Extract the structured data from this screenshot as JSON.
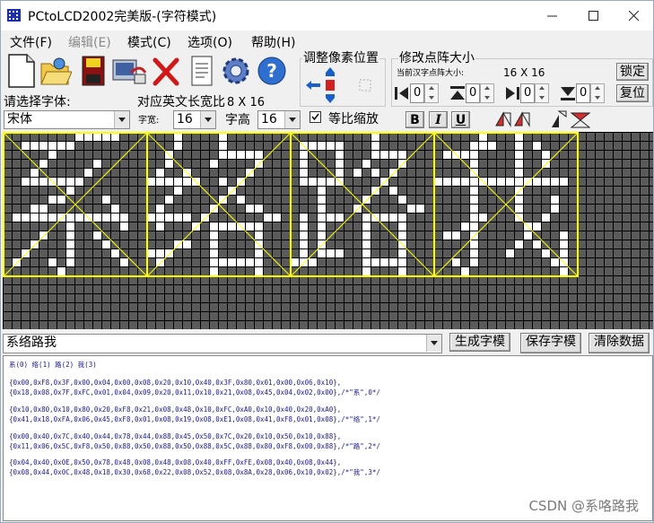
{
  "window": {
    "title": "PCtoLCD2002完美版-(字符模式)",
    "controls": [
      "minimize",
      "maximize",
      "close"
    ]
  },
  "menu": [
    {
      "label": "文件(F)",
      "enabled": true
    },
    {
      "label": "编辑(E)",
      "enabled": false
    },
    {
      "label": "模式(C)",
      "enabled": true
    },
    {
      "label": "选项(O)",
      "enabled": true
    },
    {
      "label": "帮助(H)",
      "enabled": true
    }
  ],
  "toolbar": [
    "new-file-icon",
    "open-folder-icon",
    "save-disk-icon",
    "options-icon",
    "delete-icon",
    "notepad-icon",
    "settings-gear-icon",
    "help-icon"
  ],
  "adjust_group": {
    "title": "调整像素位置"
  },
  "resize_group": {
    "title": "修改点阵大小",
    "current_label": "当前汉字点阵大小:",
    "current_value": "16 X 16",
    "lock_label": "锁定",
    "reset_label": "复位",
    "spins": [
      "0",
      "0",
      "0",
      "0"
    ]
  },
  "font": {
    "select_label": "请选择字体:",
    "select_value": "宋体",
    "ratio_label": "对应英文长宽比",
    "ratio_value": "8 X 16",
    "width_label": "字宽:",
    "width_value": "16",
    "height_label": "字高",
    "height_value": "16",
    "proportional_label": "等比缩放",
    "proportional_checked": true,
    "bold": "B",
    "italic": "I",
    "underline": "U"
  },
  "colors": {
    "dot_on": "#ffffff",
    "dot_off": "#5a5a5a",
    "grid": "#000000",
    "frame": "#ffff00",
    "output_text": "#1a1a8c"
  },
  "input": {
    "value": "系络路我",
    "generate_label": "生成字模",
    "save_label": "保存字模",
    "clear_label": "清除数据"
  },
  "output": {
    "header": "系(0) 络(1) 路(2) 我(3)",
    "blocks": [
      [
        "{0x00,0xF8,0x3F,0x00,0x04,0x00,0x08,0x20,0x10,0x40,0x3F,0x80,0x01,0x00,0x06,0x10},",
        "{0x18,0x08,0x7F,0xFC,0x01,0x04,0x09,0x20,0x11,0x10,0x21,0x08,0x45,0x04,0x02,0x00},/*\"系\",0*/"
      ],
      [
        "{0x10,0x80,0x10,0x80,0x20,0xF8,0x21,0x08,0x48,0x10,0xFC,0xA0,0x10,0x40,0x20,0xA0},",
        "{0x41,0x18,0xFA,0x06,0x45,0xF8,0x01,0x08,0x19,0x08,0xE1,0x08,0x41,0xF8,0x01,0x08},/*\"络\",1*/"
      ],
      [
        "{0x00,0x40,0x7C,0x40,0x44,0x78,0x44,0x88,0x45,0x50,0x7C,0x20,0x10,0x50,0x10,0x88},",
        "{0x11,0x06,0x5C,0xF8,0x50,0x88,0x50,0x88,0x50,0x88,0x5C,0x88,0x80,0xF8,0x00,0x88},/*\"路\",2*/"
      ],
      [
        "{0x04,0x40,0x0E,0x50,0x78,0x48,0x08,0x48,0x08,0x40,0xFF,0xFE,0x08,0x40,0x08,0x44},",
        "{0x08,0x44,0x0C,0x48,0x18,0x30,0x68,0x22,0x08,0x52,0x08,0x8A,0x28,0x06,0x10,0x02},/*\"我\",3*/"
      ]
    ]
  },
  "watermark": "CSDN @系咯路我",
  "glyphs": [
    {
      "char": "系",
      "rows": [
        [
          0,
          0,
          0,
          0,
          0,
          0,
          0,
          0,
          1,
          1,
          1,
          1,
          1,
          0,
          0,
          0
        ],
        [
          0,
          0,
          1,
          1,
          1,
          1,
          1,
          1,
          0,
          0,
          0,
          0,
          0,
          0,
          0,
          0
        ],
        [
          0,
          0,
          0,
          0,
          0,
          1,
          0,
          0,
          0,
          0,
          0,
          0,
          0,
          0,
          0,
          0
        ],
        [
          0,
          0,
          0,
          0,
          1,
          0,
          0,
          0,
          0,
          0,
          1,
          0,
          0,
          0,
          0,
          0
        ],
        [
          0,
          0,
          0,
          1,
          0,
          0,
          0,
          0,
          0,
          1,
          0,
          0,
          0,
          0,
          0,
          0
        ],
        [
          0,
          0,
          1,
          1,
          1,
          1,
          1,
          1,
          1,
          0,
          0,
          0,
          0,
          0,
          0,
          0
        ],
        [
          0,
          0,
          0,
          0,
          0,
          0,
          0,
          1,
          0,
          0,
          0,
          0,
          0,
          0,
          0,
          0
        ],
        [
          0,
          0,
          0,
          0,
          0,
          1,
          1,
          0,
          0,
          0,
          0,
          1,
          0,
          0,
          0,
          0
        ],
        [
          0,
          0,
          0,
          1,
          1,
          0,
          0,
          0,
          0,
          0,
          0,
          0,
          1,
          0,
          0,
          0
        ],
        [
          0,
          1,
          1,
          1,
          1,
          1,
          1,
          1,
          1,
          1,
          1,
          1,
          1,
          1,
          0,
          0
        ],
        [
          0,
          0,
          0,
          0,
          0,
          0,
          0,
          1,
          0,
          0,
          0,
          0,
          0,
          1,
          0,
          0
        ],
        [
          0,
          0,
          0,
          0,
          1,
          0,
          0,
          1,
          0,
          0,
          1,
          0,
          0,
          0,
          0,
          0
        ],
        [
          0,
          0,
          0,
          1,
          0,
          0,
          0,
          1,
          0,
          0,
          0,
          1,
          0,
          0,
          0,
          0
        ],
        [
          0,
          0,
          1,
          0,
          0,
          0,
          0,
          1,
          0,
          0,
          0,
          0,
          1,
          0,
          0,
          0
        ],
        [
          0,
          1,
          0,
          0,
          0,
          1,
          0,
          1,
          0,
          0,
          0,
          0,
          0,
          1,
          0,
          0
        ],
        [
          0,
          0,
          0,
          0,
          0,
          0,
          1,
          0,
          0,
          0,
          0,
          0,
          0,
          0,
          0,
          0
        ]
      ]
    },
    {
      "char": "络",
      "rows": [
        [
          0,
          0,
          0,
          1,
          0,
          0,
          0,
          0,
          1,
          0,
          0,
          0,
          0,
          0,
          0,
          0
        ],
        [
          0,
          0,
          0,
          1,
          0,
          0,
          0,
          0,
          1,
          0,
          0,
          0,
          0,
          0,
          0,
          0
        ],
        [
          0,
          0,
          1,
          0,
          0,
          0,
          0,
          0,
          1,
          1,
          1,
          1,
          1,
          0,
          0,
          0
        ],
        [
          0,
          0,
          1,
          0,
          0,
          0,
          0,
          1,
          0,
          0,
          0,
          0,
          1,
          0,
          0,
          0
        ],
        [
          0,
          1,
          0,
          0,
          1,
          0,
          0,
          0,
          0,
          0,
          0,
          1,
          0,
          0,
          0,
          0
        ],
        [
          1,
          1,
          1,
          1,
          1,
          1,
          0,
          0,
          1,
          0,
          1,
          0,
          0,
          0,
          0,
          0
        ],
        [
          0,
          0,
          0,
          1,
          0,
          0,
          0,
          0,
          0,
          1,
          0,
          0,
          0,
          0,
          0,
          0
        ],
        [
          0,
          0,
          1,
          0,
          0,
          0,
          0,
          0,
          1,
          0,
          1,
          0,
          0,
          0,
          0,
          0
        ],
        [
          0,
          1,
          0,
          0,
          0,
          0,
          0,
          1,
          0,
          0,
          0,
          1,
          1,
          0,
          0,
          0
        ],
        [
          1,
          1,
          1,
          1,
          1,
          0,
          1,
          0,
          0,
          0,
          0,
          0,
          0,
          1,
          1,
          0
        ],
        [
          0,
          1,
          0,
          0,
          0,
          1,
          0,
          1,
          1,
          1,
          1,
          1,
          1,
          0,
          0,
          0
        ],
        [
          0,
          0,
          0,
          0,
          0,
          0,
          0,
          1,
          0,
          0,
          0,
          0,
          1,
          0,
          0,
          0
        ],
        [
          0,
          0,
          0,
          1,
          1,
          0,
          0,
          1,
          0,
          0,
          0,
          0,
          1,
          0,
          0,
          0
        ],
        [
          1,
          1,
          1,
          0,
          0,
          0,
          0,
          1,
          0,
          0,
          0,
          0,
          1,
          0,
          0,
          0
        ],
        [
          0,
          1,
          0,
          0,
          0,
          0,
          0,
          1,
          1,
          1,
          1,
          1,
          1,
          0,
          0,
          0
        ],
        [
          0,
          0,
          0,
          0,
          0,
          0,
          0,
          1,
          0,
          0,
          0,
          0,
          1,
          0,
          0,
          0
        ]
      ]
    },
    {
      "char": "路",
      "rows": [
        [
          0,
          0,
          0,
          0,
          0,
          0,
          0,
          0,
          0,
          1,
          0,
          0,
          0,
          0,
          0,
          0
        ],
        [
          0,
          1,
          1,
          1,
          1,
          1,
          0,
          0,
          0,
          1,
          0,
          0,
          0,
          0,
          0,
          0
        ],
        [
          0,
          1,
          0,
          0,
          0,
          1,
          0,
          0,
          0,
          1,
          1,
          1,
          1,
          0,
          0,
          0
        ],
        [
          0,
          1,
          0,
          0,
          0,
          1,
          0,
          0,
          1,
          0,
          0,
          0,
          1,
          0,
          0,
          0
        ],
        [
          0,
          1,
          0,
          0,
          0,
          1,
          0,
          1,
          0,
          1,
          0,
          1,
          0,
          0,
          0,
          0
        ],
        [
          0,
          1,
          1,
          1,
          1,
          1,
          0,
          0,
          0,
          0,
          1,
          0,
          0,
          0,
          0,
          0
        ],
        [
          0,
          0,
          0,
          1,
          0,
          0,
          0,
          0,
          0,
          1,
          0,
          1,
          0,
          0,
          0,
          0
        ],
        [
          0,
          0,
          0,
          1,
          0,
          0,
          0,
          0,
          1,
          0,
          0,
          0,
          1,
          0,
          0,
          0
        ],
        [
          0,
          0,
          0,
          1,
          0,
          0,
          0,
          1,
          0,
          0,
          0,
          0,
          0,
          1,
          1,
          0
        ],
        [
          0,
          1,
          0,
          1,
          1,
          1,
          0,
          0,
          1,
          1,
          1,
          1,
          1,
          0,
          0,
          0
        ],
        [
          0,
          1,
          0,
          1,
          0,
          0,
          0,
          0,
          1,
          0,
          0,
          0,
          1,
          0,
          0,
          0
        ],
        [
          0,
          1,
          0,
          1,
          0,
          0,
          0,
          0,
          1,
          0,
          0,
          0,
          1,
          0,
          0,
          0
        ],
        [
          0,
          1,
          0,
          1,
          0,
          0,
          0,
          0,
          1,
          0,
          0,
          0,
          1,
          0,
          0,
          0
        ],
        [
          0,
          1,
          0,
          1,
          1,
          1,
          0,
          0,
          1,
          0,
          0,
          0,
          1,
          0,
          0,
          0
        ],
        [
          1,
          1,
          1,
          0,
          0,
          0,
          0,
          0,
          1,
          1,
          1,
          1,
          1,
          0,
          0,
          0
        ],
        [
          0,
          0,
          0,
          0,
          0,
          0,
          0,
          0,
          1,
          0,
          0,
          0,
          1,
          0,
          0,
          0
        ]
      ]
    },
    {
      "char": "我",
      "rows": [
        [
          0,
          0,
          0,
          0,
          0,
          1,
          0,
          0,
          0,
          1,
          0,
          0,
          0,
          0,
          0,
          0
        ],
        [
          0,
          0,
          0,
          0,
          1,
          1,
          1,
          0,
          0,
          1,
          0,
          1,
          0,
          0,
          0,
          0
        ],
        [
          0,
          1,
          1,
          1,
          1,
          0,
          0,
          0,
          0,
          1,
          0,
          0,
          1,
          0,
          0,
          0
        ],
        [
          0,
          0,
          0,
          0,
          1,
          0,
          0,
          0,
          0,
          1,
          0,
          0,
          1,
          0,
          0,
          0
        ],
        [
          0,
          0,
          0,
          0,
          1,
          0,
          0,
          0,
          0,
          1,
          0,
          0,
          0,
          0,
          0,
          0
        ],
        [
          1,
          1,
          1,
          1,
          1,
          1,
          1,
          1,
          1,
          1,
          1,
          1,
          1,
          1,
          1,
          0
        ],
        [
          0,
          0,
          0,
          0,
          1,
          0,
          0,
          0,
          0,
          1,
          0,
          0,
          0,
          0,
          0,
          0
        ],
        [
          0,
          0,
          0,
          0,
          1,
          0,
          0,
          0,
          0,
          1,
          0,
          0,
          0,
          1,
          0,
          0
        ],
        [
          0,
          0,
          0,
          0,
          1,
          0,
          0,
          0,
          0,
          1,
          0,
          0,
          0,
          1,
          0,
          0
        ],
        [
          0,
          0,
          0,
          0,
          1,
          1,
          0,
          0,
          0,
          1,
          0,
          0,
          1,
          0,
          0,
          0
        ],
        [
          0,
          0,
          0,
          1,
          1,
          0,
          0,
          0,
          0,
          0,
          1,
          1,
          0,
          0,
          0,
          0
        ],
        [
          0,
          1,
          1,
          0,
          1,
          0,
          0,
          0,
          0,
          0,
          1,
          0,
          0,
          0,
          1,
          0
        ],
        [
          0,
          0,
          0,
          0,
          1,
          0,
          0,
          0,
          0,
          1,
          0,
          1,
          0,
          0,
          1,
          0
        ],
        [
          0,
          0,
          0,
          0,
          1,
          0,
          0,
          0,
          1,
          0,
          0,
          0,
          1,
          0,
          1,
          0
        ],
        [
          0,
          0,
          1,
          0,
          1,
          0,
          0,
          0,
          0,
          0,
          0,
          0,
          0,
          1,
          1,
          0
        ],
        [
          0,
          0,
          0,
          1,
          0,
          0,
          0,
          0,
          0,
          0,
          0,
          0,
          0,
          0,
          1,
          0
        ]
      ]
    }
  ]
}
